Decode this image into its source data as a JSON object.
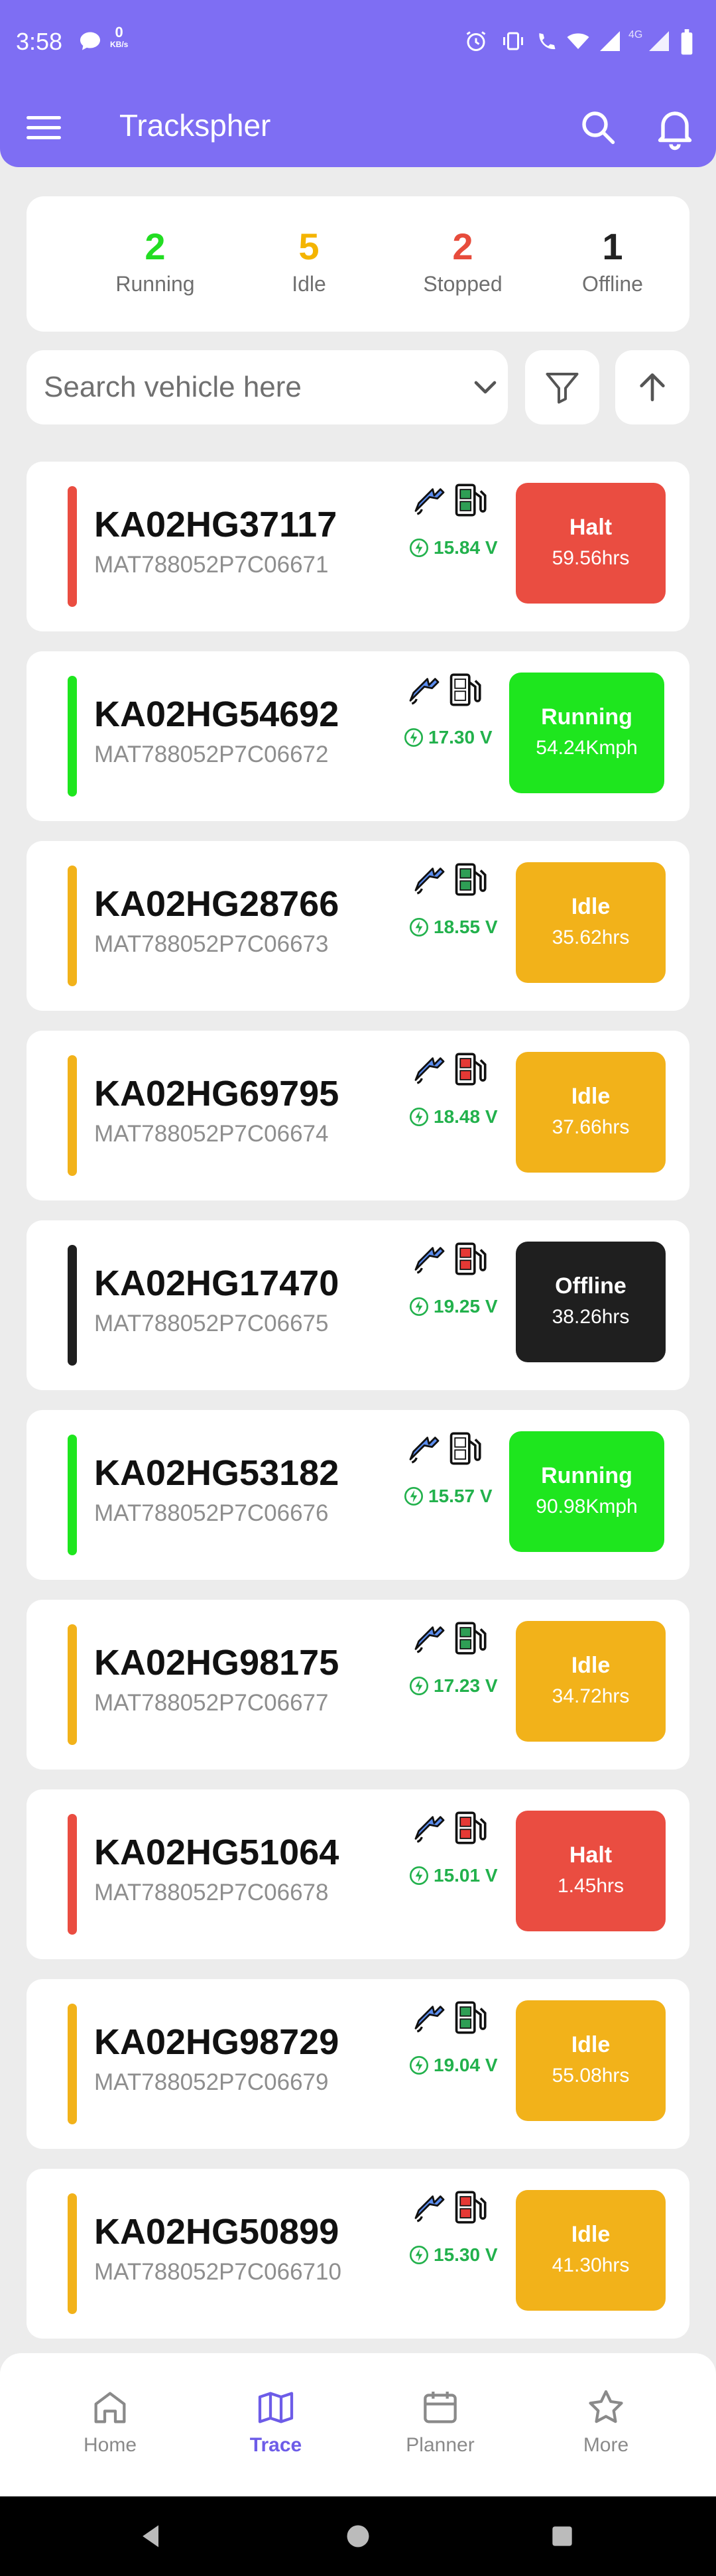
{
  "status_bar": {
    "time": "3:58",
    "net_speed": "0",
    "net_unit": "KB/s",
    "net_type": "4G"
  },
  "app_bar": {
    "title": "Trackspher"
  },
  "summary": [
    {
      "count": "2",
      "label": "Running",
      "color": "#22dd22"
    },
    {
      "count": "5",
      "label": "Idle",
      "color": "#f4b400"
    },
    {
      "count": "2",
      "label": "Stopped",
      "color": "#e74c3c"
    },
    {
      "count": "1",
      "label": "Offline",
      "color": "#222222"
    }
  ],
  "search": {
    "placeholder": "Search vehicle here"
  },
  "vehicles": [
    {
      "plate": "KA02HG37117",
      "vin": "MAT788052P7C06671",
      "voltage": "15.84 V",
      "status": "Halt",
      "metric": "59.56hrs",
      "color": "#ea4d41",
      "fuel_level": "high"
    },
    {
      "plate": "KA02HG54692",
      "vin": "MAT788052P7C06672",
      "voltage": "17.30 V",
      "status": "Running",
      "metric": "54.24Kmph",
      "color": "#1ee61e",
      "fuel_level": "mid"
    },
    {
      "plate": "KA02HG28766",
      "vin": "MAT788052P7C06673",
      "voltage": "18.55 V",
      "status": "Idle",
      "metric": "35.62hrs",
      "color": "#f2b21a",
      "fuel_level": "high"
    },
    {
      "plate": "KA02HG69795",
      "vin": "MAT788052P7C06674",
      "voltage": "18.48 V",
      "status": "Idle",
      "metric": "37.66hrs",
      "color": "#f2b21a",
      "fuel_level": "low"
    },
    {
      "plate": "KA02HG17470",
      "vin": "MAT788052P7C06675",
      "voltage": "19.25 V",
      "status": "Offline",
      "metric": "38.26hrs",
      "color": "#1f1f1f",
      "fuel_level": "low"
    },
    {
      "plate": "KA02HG53182",
      "vin": "MAT788052P7C06676",
      "voltage": "15.57 V",
      "status": "Running",
      "metric": "90.98Kmph",
      "color": "#1ee61e",
      "fuel_level": "mid"
    },
    {
      "plate": "KA02HG98175",
      "vin": "MAT788052P7C06677",
      "voltage": "17.23 V",
      "status": "Idle",
      "metric": "34.72hrs",
      "color": "#f2b21a",
      "fuel_level": "high"
    },
    {
      "plate": "KA02HG51064",
      "vin": "MAT788052P7C06678",
      "voltage": "15.01 V",
      "status": "Halt",
      "metric": "1.45hrs",
      "color": "#ea4d41",
      "fuel_level": "low"
    },
    {
      "plate": "KA02HG98729",
      "vin": "MAT788052P7C06679",
      "voltage": "19.04 V",
      "status": "Idle",
      "metric": "55.08hrs",
      "color": "#f2b21a",
      "fuel_level": "high"
    },
    {
      "plate": "KA02HG50899",
      "vin": "MAT788052P7C066710",
      "voltage": "15.30 V",
      "status": "Idle",
      "metric": "41.30hrs",
      "color": "#f2b21a",
      "fuel_level": "low"
    }
  ],
  "bottom_nav": [
    {
      "label": "Home",
      "icon": "home-icon",
      "active": false
    },
    {
      "label": "Trace",
      "icon": "map-icon",
      "active": true
    },
    {
      "label": "Planner",
      "icon": "calendar-icon",
      "active": false
    },
    {
      "label": "More",
      "icon": "star-icon",
      "active": false
    }
  ],
  "colors": {
    "primary": "#7e6ef3",
    "active_nav": "#6d5ce8",
    "voltage_green": "#22b14c"
  }
}
